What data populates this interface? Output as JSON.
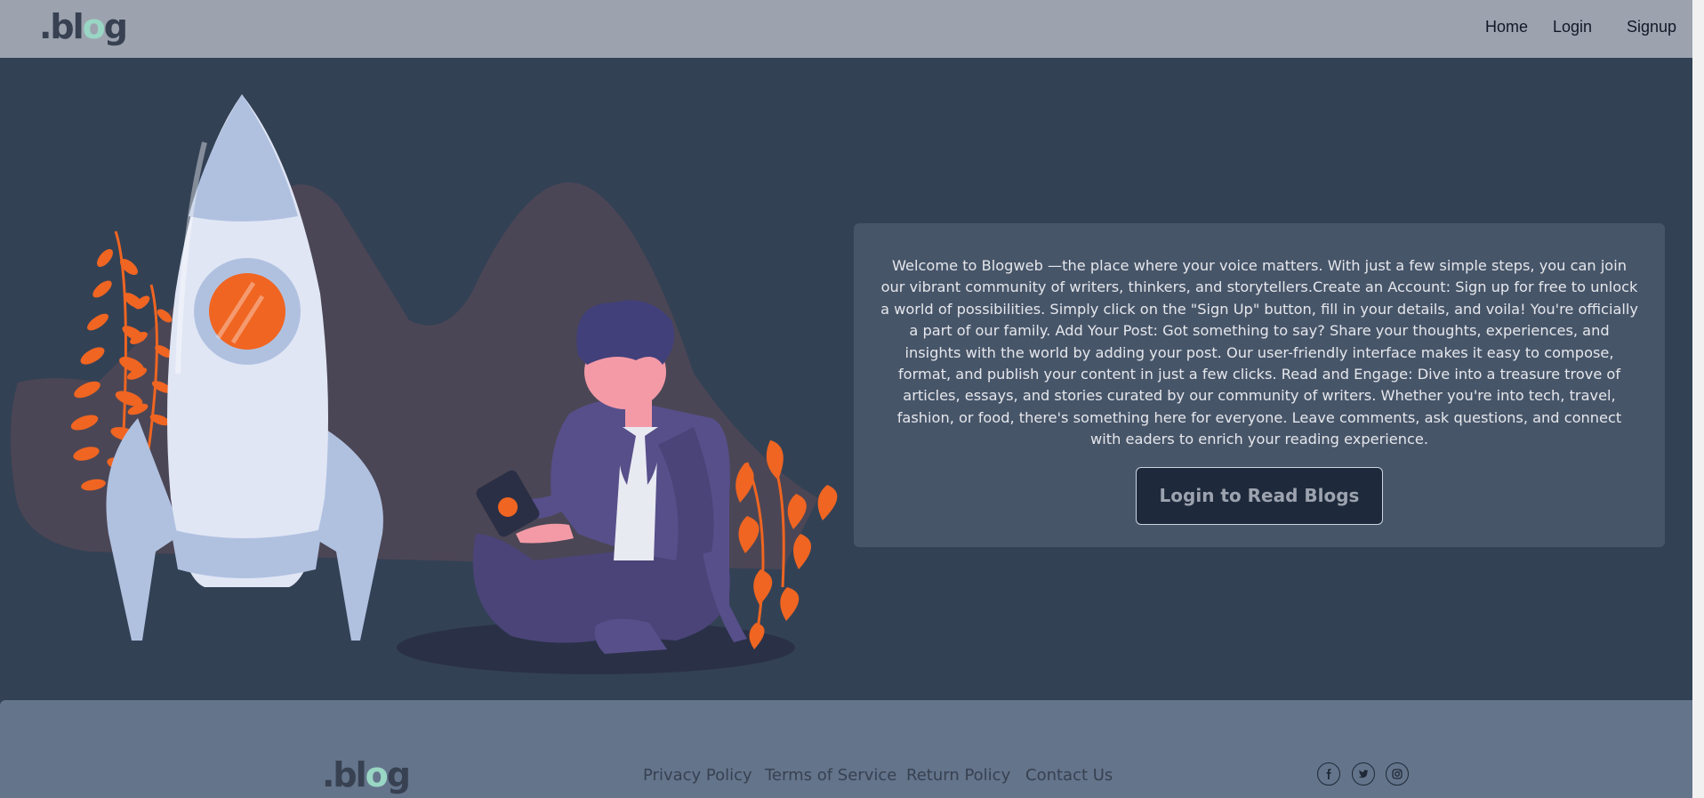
{
  "brand": {
    "logo_prefix": ".bl",
    "logo_o": "o",
    "logo_suffix": "g"
  },
  "nav": {
    "home": "Home",
    "login": "Login",
    "signup": "Signup"
  },
  "hero": {
    "welcome_text": "Welcome to Blogweb —the place where your voice matters. With just a few simple steps, you can join our vibrant community of writers, thinkers, and storytellers.Create an Account: Sign up for free to unlock a world of possibilities. Simply click on the \"Sign Up\" button, fill in your details, and voila! You're officially a part of our family. Add Your Post: Got something to say? Share your thoughts, experiences, and insights with the world by adding your post. Our user-friendly interface makes it easy to compose, format, and publish your content in just a few clicks. Read and Engage: Dive into a treasure trove of articles, essays, and stories curated by our community of writers. Whether you're into tech, travel, fashion, or food, there's something here for everyone. Leave comments, ask questions, and connect with eaders to enrich your reading experience.",
    "cta_label": "Login to Read Blogs"
  },
  "footer": {
    "links": [
      "Privacy Policy",
      "Terms of Service",
      "Return Policy",
      "Contact Us"
    ],
    "social_icons": [
      "facebook-icon",
      "twitter-icon",
      "instagram-icon"
    ]
  },
  "colors": {
    "navbar": "#9ca3af",
    "hero_bg": "#334155",
    "card_bg": "#475569",
    "button_bg": "#1e293b",
    "footer_bg": "#64748b",
    "accent_orange": "#f06521",
    "logo_accent": "#99d6c4"
  }
}
